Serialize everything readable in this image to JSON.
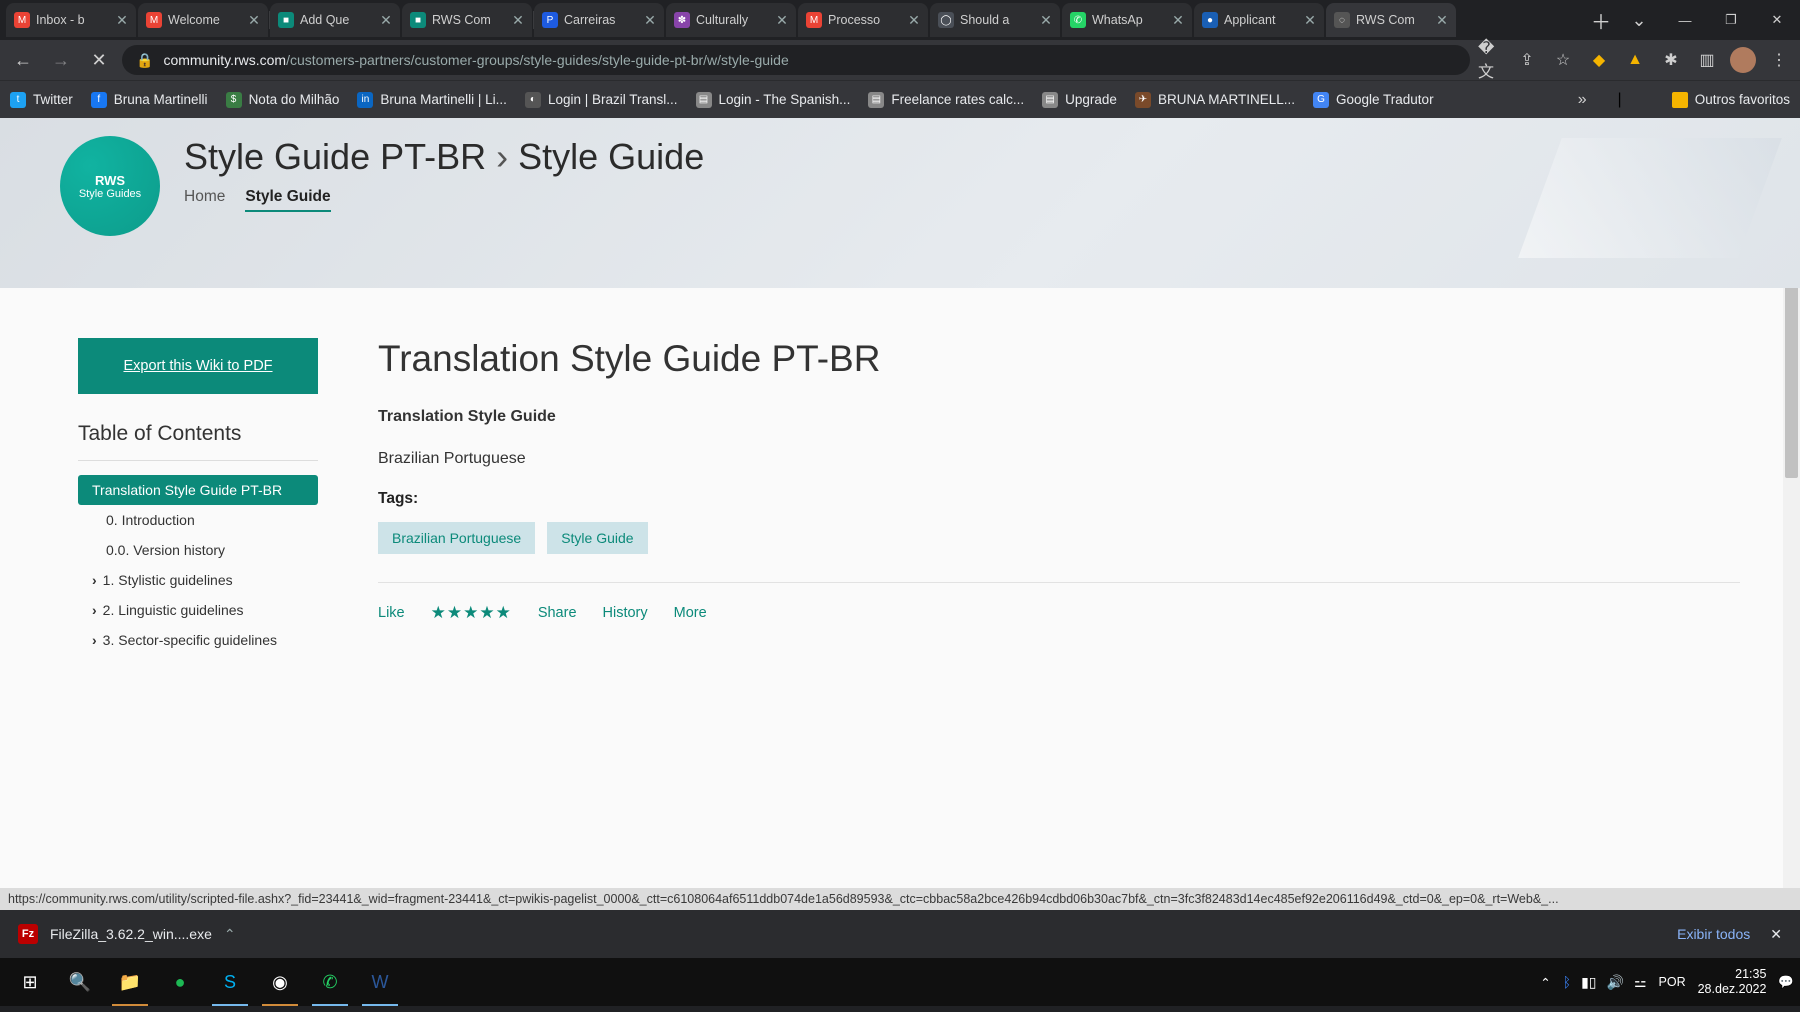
{
  "chrome": {
    "tabs": [
      {
        "label": "Inbox - b",
        "fav_bg": "#ea4335",
        "fav_txt": "M"
      },
      {
        "label": "Welcome",
        "fav_bg": "#ea4335",
        "fav_txt": "M"
      },
      {
        "label": "Add Que",
        "fav_bg": "#0c8a7a",
        "fav_txt": "■"
      },
      {
        "label": "RWS Com",
        "fav_bg": "#0c8a7a",
        "fav_txt": "■"
      },
      {
        "label": "Carreiras",
        "fav_bg": "#1e5be0",
        "fav_txt": "P"
      },
      {
        "label": "Culturally",
        "fav_bg": "#8844aa",
        "fav_txt": "✽"
      },
      {
        "label": "Processo",
        "fav_bg": "#ea4335",
        "fav_txt": "M"
      },
      {
        "label": "Should a",
        "fav_bg": "#4a4f57",
        "fav_txt": "◯"
      },
      {
        "label": "WhatsAp",
        "fav_bg": "#25d366",
        "fav_txt": "✆"
      },
      {
        "label": "Applicant",
        "fav_bg": "#1a5fb4",
        "fav_txt": "●"
      },
      {
        "label": "RWS Com",
        "fav_bg": "#555",
        "fav_txt": "◌",
        "active": true
      }
    ],
    "url_host": "community.rws.com",
    "url_path": "/customers-partners/customer-groups/style-guides/style-guide-pt-br/w/style-guide",
    "bookmarks": [
      {
        "label": "Twitter",
        "bg": "#1da1f2",
        "txt": "t"
      },
      {
        "label": "Bruna Martinelli",
        "bg": "#1877f2",
        "txt": "f"
      },
      {
        "label": "Nota do Milhão",
        "bg": "#3a7d44",
        "txt": "$"
      },
      {
        "label": "Bruna Martinelli | Li...",
        "bg": "#0a66c2",
        "txt": "in"
      },
      {
        "label": "Login | Brazil Transl...",
        "bg": "#555",
        "txt": "◐"
      },
      {
        "label": "Login - The Spanish...",
        "bg": "#888",
        "txt": "▤"
      },
      {
        "label": "Freelance rates calc...",
        "bg": "#888",
        "txt": "▤"
      },
      {
        "label": "Upgrade",
        "bg": "#888",
        "txt": "▤"
      },
      {
        "label": "BRUNA MARTINELL...",
        "bg": "#7a4a2a",
        "txt": "✈"
      },
      {
        "label": "Google Tradutor",
        "bg": "#4285f4",
        "txt": "G"
      }
    ],
    "other_bookmarks": "Outros favoritos"
  },
  "page": {
    "badge_brand": "RWS",
    "badge_sub": "Style Guides",
    "title_a": "Style Guide PT-BR",
    "title_b": "Style Guide",
    "crumb_home": "Home",
    "crumb_active": "Style Guide",
    "export_btn": "Export this Wiki to PDF",
    "toc_head": "Table of Contents",
    "toc": {
      "active": "Translation Style Guide PT-BR",
      "c1": "0. Introduction",
      "c2": "0.0. Version history",
      "p1": "1. Stylistic guidelines",
      "p2": "2. Linguistic guidelines",
      "p3": "3. Sector-specific guidelines"
    },
    "main_title": "Translation Style Guide PT-BR",
    "main_sub": "Translation Style Guide",
    "main_lang": "Brazilian Portuguese",
    "tags_head": "Tags:",
    "tag1": "Brazilian Portuguese",
    "tag2": "Style Guide",
    "act_like": "Like",
    "act_share": "Share",
    "act_history": "History",
    "act_more": "More"
  },
  "status_url": "https://community.rws.com/utility/scripted-file.ashx?_fid=23441&_wid=fragment-23441&_ct=pwikis-pagelist_0000&_ctt=c6108064af6511ddb074de1a56d89593&_ctc=cbbac58a2bce426b94cdbd06b30ac7bf&_ctn=3fc3f82483d14ec485ef92e206116d49&_ctd=0&_ep=0&_rt=Web&_...",
  "downloads": {
    "file": "FileZilla_3.62.2_win....exe",
    "show_all": "Exibir todos"
  },
  "taskbar": {
    "ime": "POR",
    "time": "21:35",
    "date": "28.dez.2022"
  }
}
